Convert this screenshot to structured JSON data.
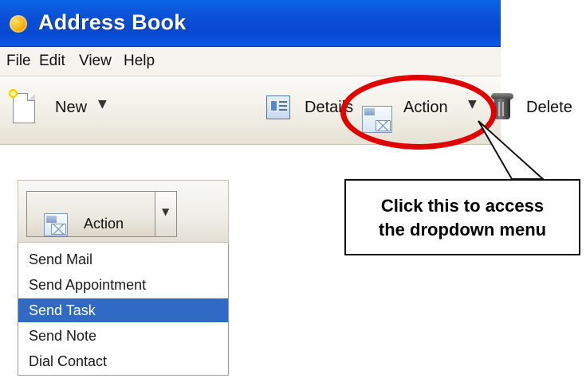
{
  "window": {
    "title": "Address Book"
  },
  "menu": {
    "file": "File",
    "edit": "Edit",
    "view": "View",
    "help": "Help"
  },
  "toolbar": {
    "new_label": "New",
    "details_label": "Details",
    "delete_label": "Delete",
    "action_label": "Action"
  },
  "callout": {
    "line1": "Click this to access",
    "line2": "the dropdown menu"
  },
  "dropdown": {
    "action_label": "Action",
    "items": [
      "Send Mail",
      "Send Appointment",
      "Send Task",
      "Send Note",
      "Dial Contact"
    ],
    "selected_item": "Send Task"
  },
  "icons": {
    "app": "address-book-icon",
    "new": "new-document-icon",
    "details": "details-icon",
    "delete": "trash-icon",
    "action": "mail-action-icon",
    "dropdown": "chevron-down-icon"
  },
  "colors": {
    "titlebar_blue": "#0a4fd5",
    "highlight_red": "#e10000",
    "selection_blue": "#316ac5"
  }
}
